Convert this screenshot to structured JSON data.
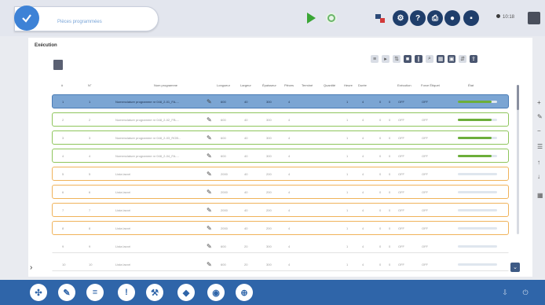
{
  "app": {
    "title": "Pièces programmées",
    "time": "10:18"
  },
  "panel": {
    "title": "Exécution"
  },
  "table": {
    "headers": [
      "#",
      "N°",
      "Nom programme",
      "Longueur",
      "Largeur",
      "Épaisseur",
      "Pièces",
      "Terminé",
      "Quantité",
      "Heure",
      "Durée",
      "",
      "Exécution",
      "Force Étiquet",
      "État"
    ],
    "rows": [
      {
        "status": "selected",
        "num": "1",
        "n": "1",
        "name": "Nomenclature programme nr 048_2-01_FA-...",
        "len": "600",
        "wid": "40",
        "thk": "300",
        "qty": "4",
        "a": "1",
        "b": "4",
        "c": "0",
        "d": "0",
        "exec": "OFF",
        "force": "OFF",
        "progress": 0.85
      },
      {
        "status": "green",
        "num": "2",
        "n": "2",
        "name": "Nomenclature programme nr 048_2-02_FB-...",
        "len": "600",
        "wid": "40",
        "thk": "300",
        "qty": "4",
        "a": "1",
        "b": "4",
        "c": "0",
        "d": "0",
        "exec": "OFF",
        "force": "OFF",
        "progress": 0.85
      },
      {
        "status": "green",
        "num": "3",
        "n": "3",
        "name": "Nomenclature programme nr 048_2-03_ROB...",
        "len": "600",
        "wid": "40",
        "thk": "300",
        "qty": "4",
        "a": "1",
        "b": "4",
        "c": "0",
        "d": "0",
        "exec": "OFF",
        "force": "OFF",
        "progress": 0.85
      },
      {
        "status": "green",
        "num": "4",
        "n": "4",
        "name": "Nomenclature programme nr 048_2-04_FA-...",
        "len": "600",
        "wid": "40",
        "thk": "300",
        "qty": "4",
        "a": "1",
        "b": "4",
        "c": "0",
        "d": "0",
        "exec": "OFF",
        "force": "OFF",
        "progress": 0.85
      },
      {
        "status": "orange",
        "num": "5",
        "n": "5",
        "name": "Lista lavori",
        "len": "2000",
        "wid": "40",
        "thk": "200",
        "qty": "4",
        "a": "1",
        "b": "4",
        "c": "0",
        "d": "0",
        "exec": "OFF",
        "force": "OFF",
        "progress": 0
      },
      {
        "status": "orange",
        "num": "6",
        "n": "6",
        "name": "Lista lavori",
        "len": "2000",
        "wid": "40",
        "thk": "200",
        "qty": "4",
        "a": "1",
        "b": "4",
        "c": "0",
        "d": "0",
        "exec": "OFF",
        "force": "OFF",
        "progress": 0
      },
      {
        "status": "orange",
        "num": "7",
        "n": "7",
        "name": "Lista lavori",
        "len": "2000",
        "wid": "40",
        "thk": "200",
        "qty": "4",
        "a": "1",
        "b": "4",
        "c": "0",
        "d": "0",
        "exec": "OFF",
        "force": "OFF",
        "progress": 0
      },
      {
        "status": "orange",
        "num": "8",
        "n": "8",
        "name": "Lista lavori",
        "len": "2000",
        "wid": "40",
        "thk": "200",
        "qty": "4",
        "a": "1",
        "b": "4",
        "c": "0",
        "d": "0",
        "exec": "OFF",
        "force": "OFF",
        "progress": 0
      },
      {
        "status": "plain",
        "num": "9",
        "n": "9",
        "name": "Lista lavori",
        "len": "600",
        "wid": "20",
        "thk": "300",
        "qty": "4",
        "a": "1",
        "b": "4",
        "c": "0",
        "d": "0",
        "exec": "OFF",
        "force": "OFF",
        "progress": 0
      },
      {
        "status": "plain",
        "num": "10",
        "n": "10",
        "name": "Lista lavori",
        "len": "600",
        "wid": "20",
        "thk": "300",
        "qty": "4",
        "a": "1",
        "b": "4",
        "c": "0",
        "d": "0",
        "exec": "OFF",
        "force": "OFF",
        "progress": 0
      }
    ]
  },
  "icons": {
    "top": [
      "check-icon",
      "play-icon",
      "refresh-icon",
      "machine-icon",
      "settings-icon",
      "help-icon",
      "print-icon",
      "user-icon",
      "lock-icon",
      "menu-icon"
    ],
    "bottom": [
      "network-icon",
      "edit-icon",
      "list-icon",
      "alert-icon",
      "tools-icon",
      "cube-icon",
      "camera-icon",
      "globe-icon"
    ]
  },
  "colors": {
    "accent": "#2f65a9",
    "selected": "#7ba5d3",
    "done": "#8ec55c",
    "pending": "#f0b35a"
  }
}
